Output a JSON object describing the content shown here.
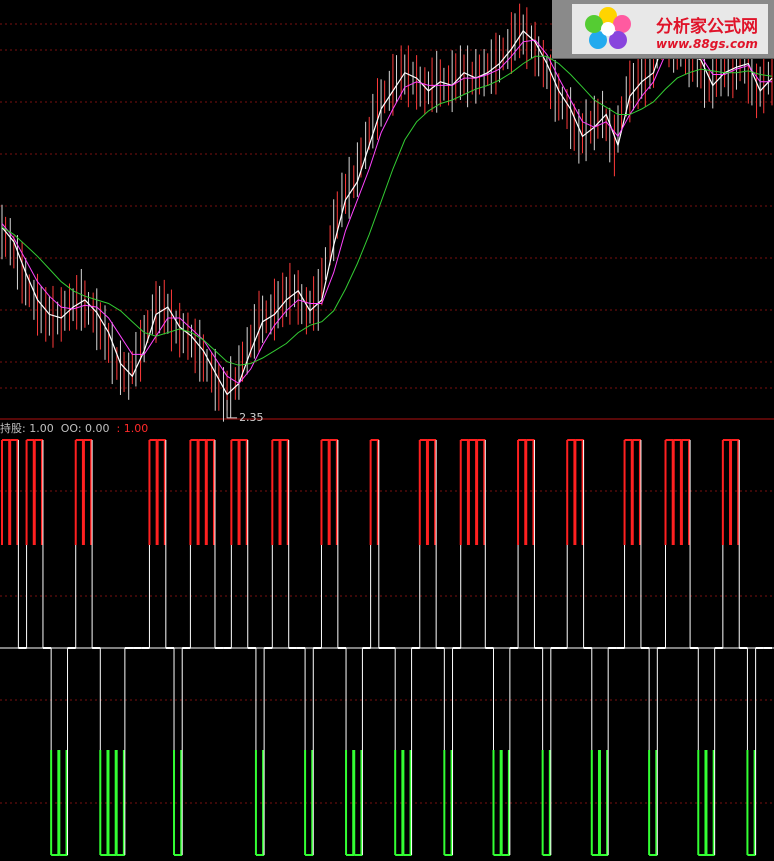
{
  "chart_data": {
    "type": "line",
    "price_panel": {
      "series": [
        {
          "color": "#ffffff",
          "values": [
            3.3,
            3.22,
            3.05,
            2.9,
            2.82,
            2.8,
            2.86,
            2.9,
            2.83,
            2.72,
            2.55,
            2.48,
            2.62,
            2.82,
            2.86,
            2.75,
            2.7,
            2.62,
            2.5,
            2.38,
            2.44,
            2.62,
            2.78,
            2.82,
            2.9,
            2.95,
            2.84,
            2.9,
            3.2,
            3.45,
            3.55,
            3.75,
            3.95,
            4.05,
            4.15,
            4.12,
            4.05,
            4.1,
            4.08,
            4.15,
            4.12,
            4.15,
            4.2,
            4.28,
            4.38,
            4.32,
            4.2,
            4.05,
            3.95,
            3.8,
            3.85,
            3.92,
            3.75,
            4.02,
            4.1,
            4.15,
            4.35,
            4.32,
            4.25,
            4.22,
            4.08,
            4.15,
            4.18,
            4.2,
            4.05,
            4.12
          ]
        },
        {
          "color": "#ff44ff",
          "values": [
            3.32,
            3.24,
            3.12,
            3.0,
            2.92,
            2.86,
            2.85,
            2.87,
            2.86,
            2.8,
            2.7,
            2.6,
            2.6,
            2.7,
            2.8,
            2.8,
            2.74,
            2.68,
            2.58,
            2.48,
            2.44,
            2.52,
            2.65,
            2.76,
            2.84,
            2.9,
            2.88,
            2.88,
            3.05,
            3.28,
            3.45,
            3.62,
            3.82,
            3.95,
            4.07,
            4.1,
            4.08,
            4.08,
            4.08,
            4.12,
            4.12,
            4.14,
            4.17,
            4.24,
            4.32,
            4.33,
            4.25,
            4.12,
            4.0,
            3.88,
            3.85,
            3.88,
            3.8,
            3.92,
            4.02,
            4.1,
            4.25,
            4.3,
            4.27,
            4.24,
            4.14,
            4.14,
            4.17,
            4.19,
            4.1,
            4.1
          ]
        },
        {
          "color": "#33cc33",
          "values": [
            3.3,
            3.26,
            3.2,
            3.14,
            3.07,
            3.0,
            2.95,
            2.92,
            2.9,
            2.88,
            2.84,
            2.78,
            2.72,
            2.7,
            2.72,
            2.74,
            2.72,
            2.68,
            2.62,
            2.56,
            2.54,
            2.55,
            2.58,
            2.62,
            2.66,
            2.72,
            2.76,
            2.78,
            2.84,
            2.96,
            3.1,
            3.26,
            3.44,
            3.62,
            3.78,
            3.88,
            3.94,
            3.98,
            4.0,
            4.03,
            4.06,
            4.08,
            4.11,
            4.15,
            4.2,
            4.24,
            4.24,
            4.2,
            4.14,
            4.07,
            4.0,
            3.96,
            3.92,
            3.92,
            3.95,
            3.99,
            4.06,
            4.12,
            4.15,
            4.17,
            4.16,
            4.15,
            4.15,
            4.16,
            4.14,
            4.13
          ]
        }
      ],
      "ylim": [
        2.25,
        4.55
      ],
      "low_marker": {
        "label": "2.35",
        "index": 19,
        "value": 2.35
      }
    },
    "indicator_panel": {
      "legend": [
        {
          "label": "持股: 1.00",
          "color": "#c0c0c0"
        },
        {
          "label": "OO: 0.00",
          "color": "#c0c0c0"
        },
        {
          "label": ": 1.00",
          "color": "#ff2a2a"
        }
      ],
      "signal": [
        1,
        1,
        0,
        1,
        1,
        0,
        -1,
        -1,
        0,
        1,
        1,
        0,
        -1,
        -1,
        -1,
        0,
        0,
        0,
        1,
        1,
        0,
        -1,
        0,
        1,
        1,
        1,
        0,
        0,
        1,
        1,
        0,
        -1,
        0,
        1,
        1,
        0,
        0,
        -1,
        0,
        1,
        1,
        0,
        -1,
        -1,
        0,
        1,
        0,
        0,
        -1,
        -1,
        0,
        1,
        1,
        0,
        -1,
        0,
        1,
        1,
        1,
        0,
        -1,
        -1,
        0,
        1,
        1,
        0,
        -1,
        0,
        0,
        1,
        1,
        0,
        -1,
        -1,
        0,
        0,
        1,
        1,
        0,
        -1,
        0,
        1,
        1,
        1,
        0,
        -1,
        -1,
        0,
        1,
        1,
        0,
        -1,
        0,
        0
      ]
    }
  },
  "logo": {
    "cn": "分析家公式网",
    "url": "www.88gs.com"
  }
}
